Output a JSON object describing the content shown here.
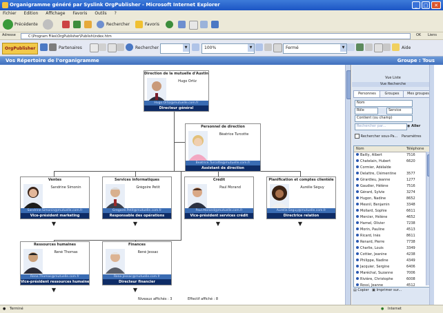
{
  "window": {
    "title": "Organigramme généré par Syslink OrgPublisher - Microsoft Internet Explorer",
    "minimize": "_",
    "maximize": "□",
    "close": "✕"
  },
  "menu": [
    "Fichier",
    "Edition",
    "Affichage",
    "Favoris",
    "Outils",
    "?"
  ],
  "toolbar1": {
    "back": "Précédente",
    "search": "Rechercher",
    "favorites": "Favoris"
  },
  "address": {
    "label": "Adresse",
    "value": "C:\\Program Files\\OrgPublisher\\Publish\\index.htm",
    "go": "OK",
    "links": "Liens"
  },
  "toolbar2": {
    "brand": "OrgPublisher",
    "partners": "Partenaires",
    "search_label": "Rechercher",
    "zoom": "100%",
    "level": "Fermé",
    "help": "Aide"
  },
  "header": {
    "title": "Vos Répertoire de l'organigramme",
    "group": "Groupe : Tous"
  },
  "cards": {
    "root": {
      "title": "Direction de la mutuelle d'Austin",
      "name": "Hugo Ortiz",
      "email": "Hugo.Ortiz@mutuelle.com.fr",
      "role": "Directeur général"
    },
    "assistant": {
      "title": "Personnel de direction",
      "name": "Béatrice Turcotte",
      "email": "Beatrice.Turcotte@mutuelle.com.fr",
      "role": "Assistant de direction"
    },
    "sales": {
      "title": "Ventes",
      "name": "Sandrine Simonin",
      "email": "Sandrine.Simonin@mutuelle.com.fr",
      "role": "Vice-président marketing"
    },
    "it": {
      "title": "Services informatiques",
      "name": "Grégoire Petit",
      "email": "Gregoire.Petit@mutuelle.com.fr",
      "role": "Responsable des opérations"
    },
    "credit": {
      "title": "Crédit",
      "name": "Paul Morand",
      "email": "Paul.Morand@mutuelle.com.fr",
      "role": "Vice-président services crédit"
    },
    "planning": {
      "title": "Planification et comptes clientèle",
      "name": "Aurélie Séguy",
      "email": "Aurelie.Seguy@mutuelle.com.fr",
      "role": "Directrice relation"
    },
    "hr": {
      "title": "Ressources humaines",
      "name": "René Thomas",
      "email": "Rene.Thomas@mutuelle.com.fr",
      "role": "Vice-président ressources humaines"
    },
    "finance": {
      "title": "Finances",
      "name": "René Jessac",
      "email": "Rene.Jessac@mutuelle.com.fr",
      "role": "Directeur financier"
    }
  },
  "expand_icon": "▼",
  "chart_status": {
    "shown": "Niveaux affichés : 3",
    "selected": "Effectif affiché : 8"
  },
  "sidebar": {
    "head1": "Vue Liste",
    "head2": "Vue Recherche",
    "tabs": [
      "Personnes",
      "Groupes",
      "Mes groupes"
    ],
    "field_name": "Nom",
    "field_role": "Rôle",
    "field_dept": "Service",
    "field_contains": "Contient (ou champ)",
    "search_hint": "Rechercher par...",
    "search_button": "Aller",
    "option_label": "Rechercher sous-Pa...",
    "option_label2": "Paramètres",
    "col_name": "Nom",
    "col_ext": "Téléphone",
    "people": [
      {
        "name": "Bailly, Albert",
        "ext": "7516"
      },
      {
        "name": "Chatelain, Hubert",
        "ext": "6620"
      },
      {
        "name": "Cormier, Adélaïde",
        "ext": ""
      },
      {
        "name": "Delattre, Clémentine",
        "ext": "3577"
      },
      {
        "name": "Girardieu, Jeanne",
        "ext": "1277"
      },
      {
        "name": "Gaudier, Hélène",
        "ext": "7516"
      },
      {
        "name": "Gérard, Sylvie",
        "ext": "3274"
      },
      {
        "name": "Hugon, Nadine",
        "ext": "8652"
      },
      {
        "name": "Mesnil, Benjamin",
        "ext": "3348"
      },
      {
        "name": "Mollard, Sophie",
        "ext": "6611"
      },
      {
        "name": "Mercier, Hélène",
        "ext": "4652"
      },
      {
        "name": "Hamel, Olivier",
        "ext": "7238"
      },
      {
        "name": "Morin, Pauline",
        "ext": "4513"
      },
      {
        "name": "Ricard, Inès",
        "ext": "8611"
      },
      {
        "name": "Renard, Pierre",
        "ext": "7738"
      },
      {
        "name": "Charlie, Louis",
        "ext": "3349"
      },
      {
        "name": "Cottier, Jeanine",
        "ext": "4238"
      },
      {
        "name": "Philippe, Nadine",
        "ext": "4349"
      },
      {
        "name": "Jacquier, Sergine",
        "ext": "6406"
      },
      {
        "name": "Maréchal, Suzanne",
        "ext": "7006"
      },
      {
        "name": "Rivière, Christophe",
        "ext": "6008"
      },
      {
        "name": "Rossi, Jeanne",
        "ext": "4512"
      }
    ],
    "bottom_copy": "Copier",
    "bottom_print": "Imprimer sur..."
  },
  "status": {
    "left": "Terminé",
    "right": "Internet"
  }
}
